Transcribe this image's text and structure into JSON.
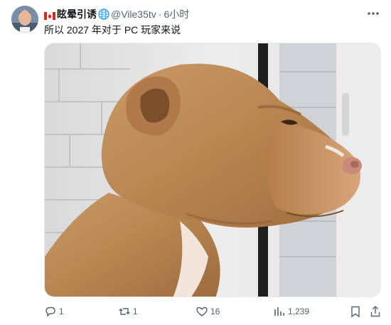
{
  "post": {
    "display_name": "眩晕引诱",
    "handle": "@Vile35tv",
    "separator": "·",
    "time_ago": "6小时",
    "text": "所以 2027 年对于 PC 玩家来说",
    "media_description_icon": "dog-side-eye-image"
  },
  "actions": {
    "reply_count": "1",
    "retweet_count": "1",
    "like_count": "16",
    "views_count": "1,239"
  },
  "colors": {
    "text_primary": "#0f1419",
    "text_secondary": "#536471"
  }
}
